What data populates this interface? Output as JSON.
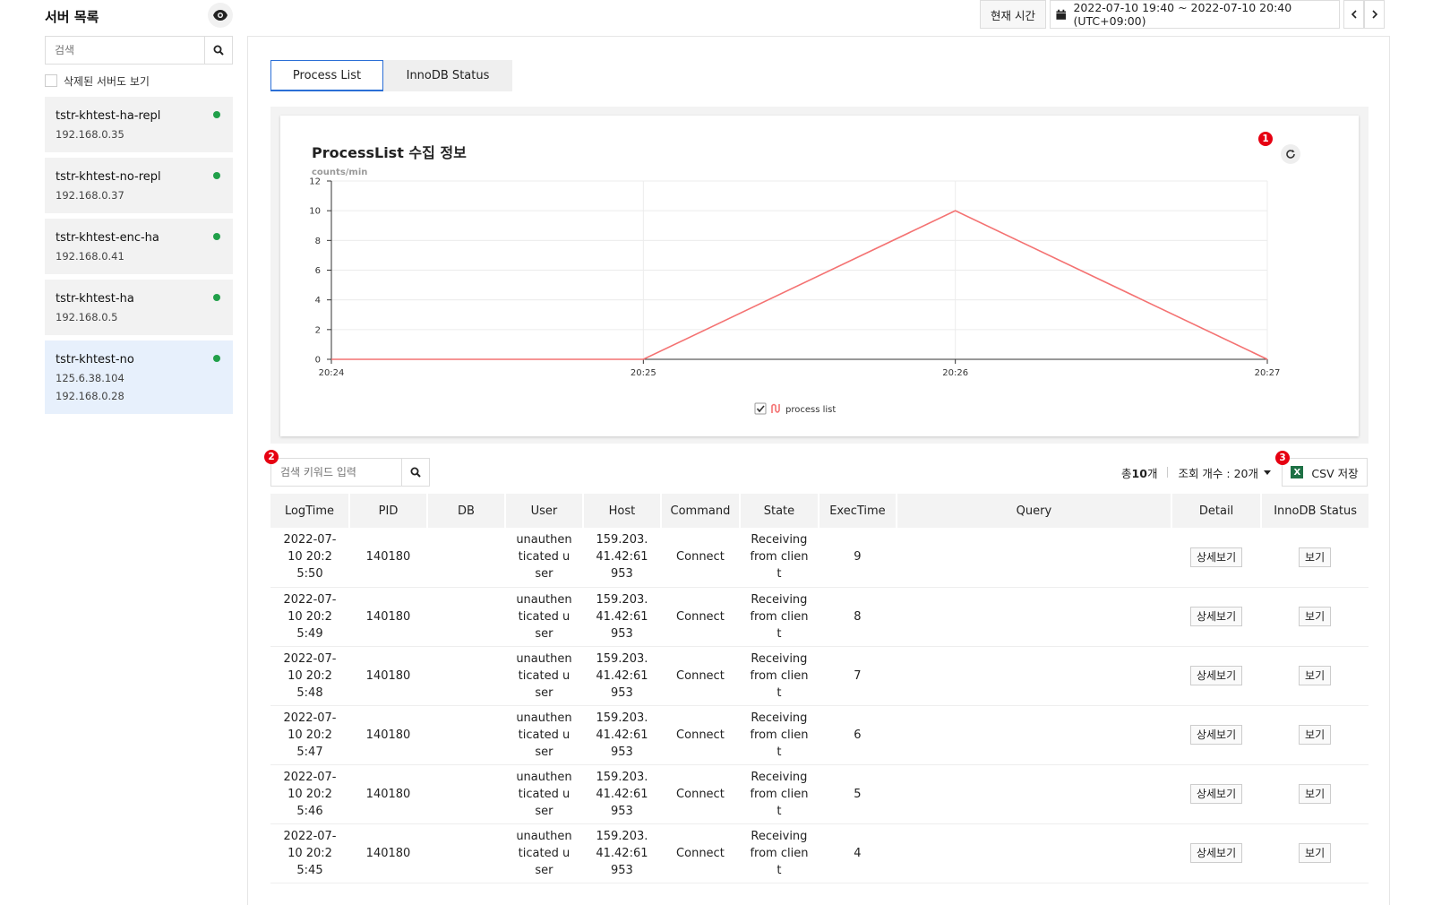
{
  "sidebar": {
    "title": "서버 목록",
    "search_placeholder": "검색",
    "show_deleted_label": "삭제된 서버도 보기",
    "servers": [
      {
        "name": "tstr-khtest-ha-repl",
        "ips": [
          "192.168.0.35"
        ],
        "status": "online",
        "selected": false
      },
      {
        "name": "tstr-khtest-no-repl",
        "ips": [
          "192.168.0.37"
        ],
        "status": "online",
        "selected": false
      },
      {
        "name": "tstr-khtest-enc-ha",
        "ips": [
          "192.168.0.41"
        ],
        "status": "online",
        "selected": false
      },
      {
        "name": "tstr-khtest-ha",
        "ips": [
          "192.168.0.5"
        ],
        "status": "online",
        "selected": false
      },
      {
        "name": "tstr-khtest-no",
        "ips": [
          "125.6.38.104",
          "192.168.0.28"
        ],
        "status": "online",
        "selected": true
      }
    ]
  },
  "topbar": {
    "now_label": "현재 시간",
    "time_range": "2022-07-10 19:40 ~ 2022-07-10 20:40 (UTC+09:00)"
  },
  "tabs": [
    {
      "label": "Process List",
      "active": true
    },
    {
      "label": "InnoDB Status",
      "active": false
    }
  ],
  "chart_data": {
    "type": "line",
    "title": "ProcessList 수집 정보",
    "ylabel": "counts/min",
    "x": [
      "20:24",
      "20:25",
      "20:26",
      "20:27"
    ],
    "ylim": [
      0,
      12
    ],
    "yticks": [
      0,
      2,
      4,
      6,
      8,
      10,
      12
    ],
    "series": [
      {
        "name": "process list",
        "values": [
          0,
          0,
          10,
          0
        ],
        "color": "#f47272"
      }
    ],
    "legend_position": "bottom-center",
    "grid": true
  },
  "badges": {
    "refresh": "1",
    "search": "2",
    "csv": "3"
  },
  "toolbar": {
    "search_placeholder": "검색 키워드 입력",
    "total_prefix": "총",
    "total_count": "10",
    "total_suffix": "개",
    "page_size_label": "조회 개수 : 20개",
    "csv_label": "CSV 저장"
  },
  "table": {
    "columns": [
      "LogTime",
      "PID",
      "DB",
      "User",
      "Host",
      "Command",
      "State",
      "ExecTime",
      "Query",
      "Detail",
      "InnoDB Status"
    ],
    "detail_button": "상세보기",
    "innodb_button": "보기",
    "rows": [
      {
        "logtime": "2022-07-10 20:25:50",
        "pid": "140180",
        "db": "",
        "user": "unauthenticated user",
        "host": "159.203.41.42:61953",
        "command": "Connect",
        "state": "Receiving from client",
        "exectime": "9",
        "query": ""
      },
      {
        "logtime": "2022-07-10 20:25:49",
        "pid": "140180",
        "db": "",
        "user": "unauthenticated user",
        "host": "159.203.41.42:61953",
        "command": "Connect",
        "state": "Receiving from client",
        "exectime": "8",
        "query": ""
      },
      {
        "logtime": "2022-07-10 20:25:48",
        "pid": "140180",
        "db": "",
        "user": "unauthenticated user",
        "host": "159.203.41.42:61953",
        "command": "Connect",
        "state": "Receiving from client",
        "exectime": "7",
        "query": ""
      },
      {
        "logtime": "2022-07-10 20:25:47",
        "pid": "140180",
        "db": "",
        "user": "unauthenticated user",
        "host": "159.203.41.42:61953",
        "command": "Connect",
        "state": "Receiving from client",
        "exectime": "6",
        "query": ""
      },
      {
        "logtime": "2022-07-10 20:25:46",
        "pid": "140180",
        "db": "",
        "user": "unauthenticated user",
        "host": "159.203.41.42:61953",
        "command": "Connect",
        "state": "Receiving from client",
        "exectime": "5",
        "query": ""
      },
      {
        "logtime": "2022-07-10 20:25:45",
        "pid": "140180",
        "db": "",
        "user": "unauthenticated user",
        "host": "159.203.41.42:61953",
        "command": "Connect",
        "state": "Receiving from client",
        "exectime": "4",
        "query": ""
      }
    ]
  }
}
